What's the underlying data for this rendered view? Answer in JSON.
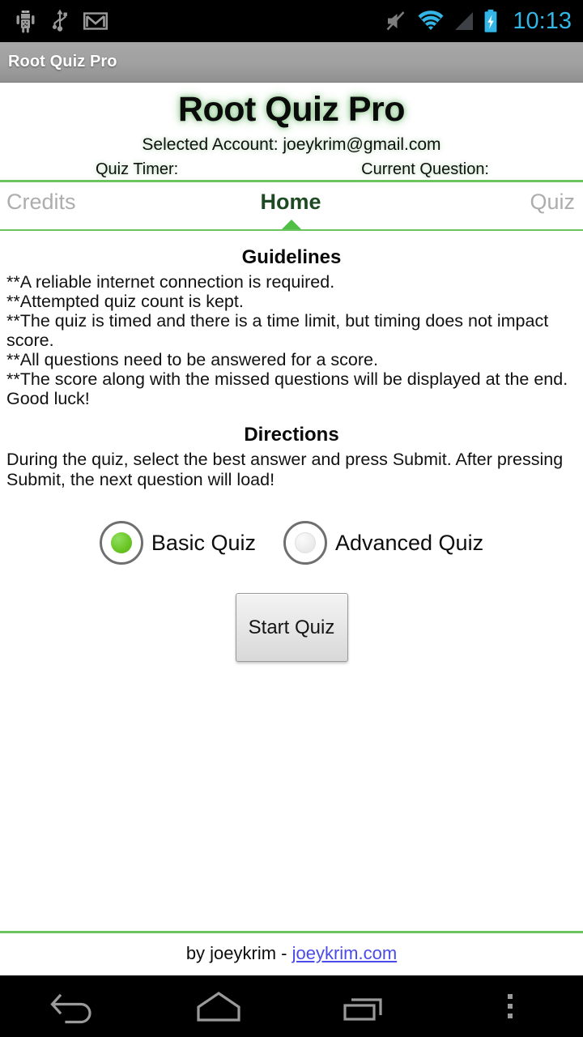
{
  "statusbar": {
    "icons": [
      "android-debug-icon",
      "usb-icon",
      "gmail-icon",
      "mute-icon",
      "wifi-icon",
      "cell-signal-icon",
      "battery-charging-icon"
    ],
    "time": "10:13",
    "time_color": "#33b5e5"
  },
  "actionbar": {
    "title": "Root Quiz Pro"
  },
  "header": {
    "app_title": "Root Quiz Pro",
    "account_line": "Selected Account: joeykrim@gmail.com",
    "quiz_timer_label": "Quiz Timer:",
    "current_question_label": "Current Question:"
  },
  "tabs": {
    "items": [
      {
        "label": "Credits",
        "active": false
      },
      {
        "label": "Home",
        "active": true
      },
      {
        "label": "Quiz",
        "active": false
      }
    ],
    "accent_color": "#6cc45e",
    "active_color": "#1d4a22",
    "inactive_color": "#adadad"
  },
  "main": {
    "guidelines_heading": "Guidelines",
    "guidelines_body": "**A reliable internet connection is required.\n**Attempted quiz count is kept.\n**The quiz is timed and there is a time limit, but timing does not impact score.\n**All questions need to be answered for a score.\n**The score along with the missed questions will be displayed at the end. Good luck!",
    "directions_heading": "Directions",
    "directions_body": "During the quiz, select the best answer and press Submit. After pressing Submit, the next question will load!",
    "quiz_modes": [
      {
        "label": "Basic Quiz",
        "selected": true
      },
      {
        "label": "Advanced Quiz",
        "selected": false
      }
    ],
    "selected_color": "#6ac423",
    "start_button_label": "Start Quiz"
  },
  "footer": {
    "byline": "by joeykrim - ",
    "link_text": "joeykrim.com",
    "link_color": "#4b4bea"
  },
  "navbar": {
    "buttons": [
      "back-icon",
      "home-icon",
      "recents-icon",
      "overflow-menu-icon"
    ]
  }
}
